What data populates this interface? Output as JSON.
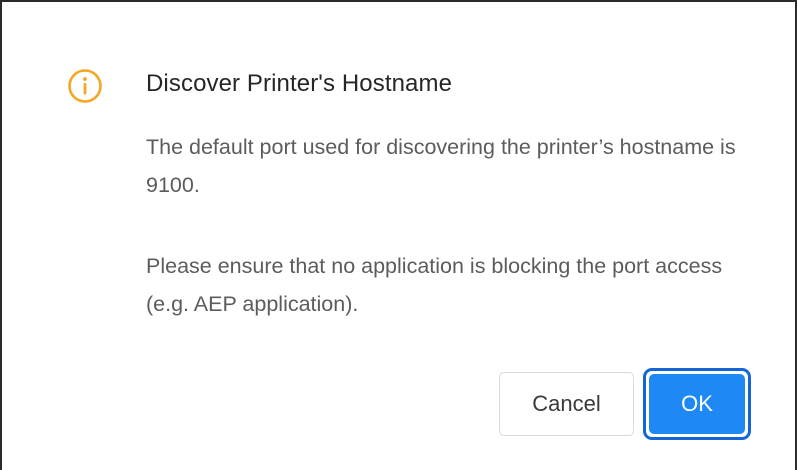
{
  "dialog": {
    "icon": "info-circle-icon",
    "icon_color": "#F5A623",
    "title": "Discover Printer's Hostname",
    "paragraph1": "The default port used for discovering the printer’s hostname is 9100.",
    "paragraph2": "Please ensure that no application is blocking the port access (e.g. AEP application).",
    "buttons": {
      "cancel_label": "Cancel",
      "ok_label": "OK"
    },
    "colors": {
      "primary": "#1E88F5",
      "focus_ring": "#1565D8",
      "title_text": "#262626",
      "body_text": "#5C5C5C"
    }
  }
}
